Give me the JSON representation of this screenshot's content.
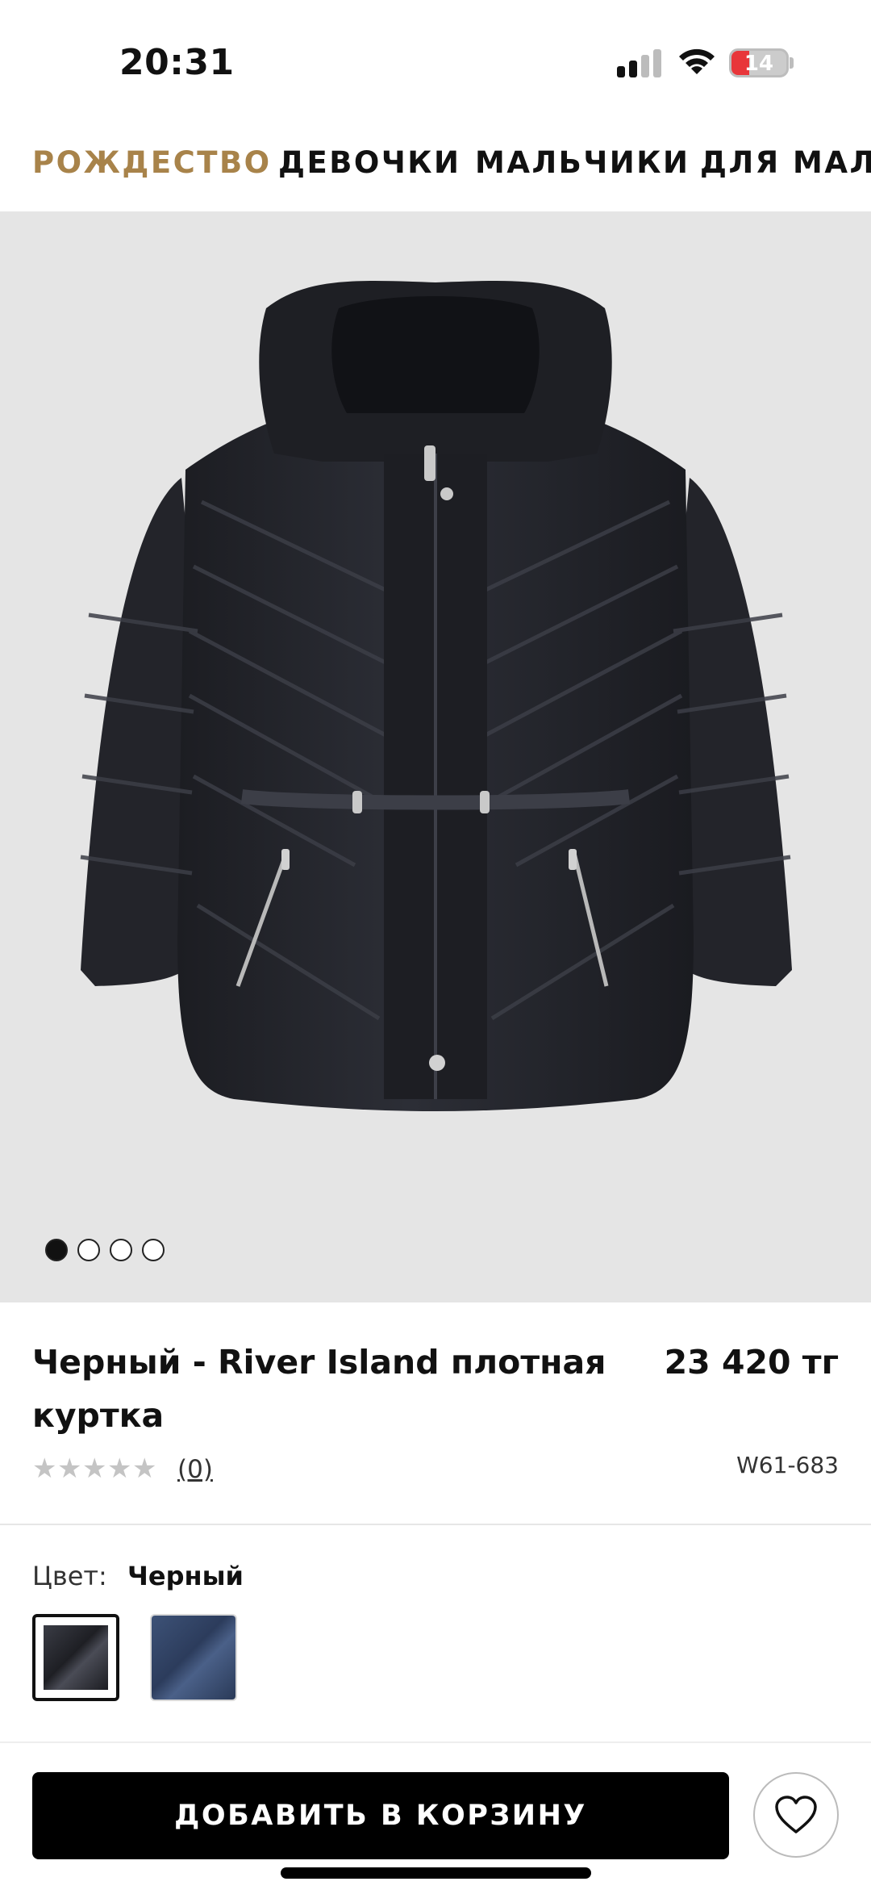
{
  "status_bar": {
    "time": "20:31",
    "battery_level": "14",
    "signal_bars_active": 2,
    "battery_fraction": 0.14
  },
  "categories": [
    {
      "label": "РОЖДЕСТВО",
      "active": true
    },
    {
      "label": "ДЕВОЧКИ",
      "active": false
    },
    {
      "label": "МАЛЬЧИКИ",
      "active": false
    },
    {
      "label": "ДЛЯ МАЛЫШЕЙ",
      "active": false
    }
  ],
  "gallery": {
    "image_count": 4,
    "current_index": 0,
    "image_icon": "puffer-jacket-photo"
  },
  "product": {
    "title": "Черный - River Island плотная куртка",
    "price": "23 420 тг",
    "rating_value": 0,
    "rating_max": 5,
    "review_count": "(0)",
    "sku": "W61-683"
  },
  "color": {
    "label": "Цвет:",
    "selected": "Черный",
    "swatches": [
      {
        "name": "black",
        "color": "#2a2c33",
        "selected": true
      },
      {
        "name": "navy",
        "color": "#34486b",
        "selected": false
      }
    ]
  },
  "actions": {
    "add_to_cart": "ДОБАВИТЬ В КОРЗИНУ",
    "wishlist_icon": "heart-icon"
  },
  "colors": {
    "accent": "#a8834a",
    "button": "#000000",
    "image_bg": "#e5e5e5"
  }
}
